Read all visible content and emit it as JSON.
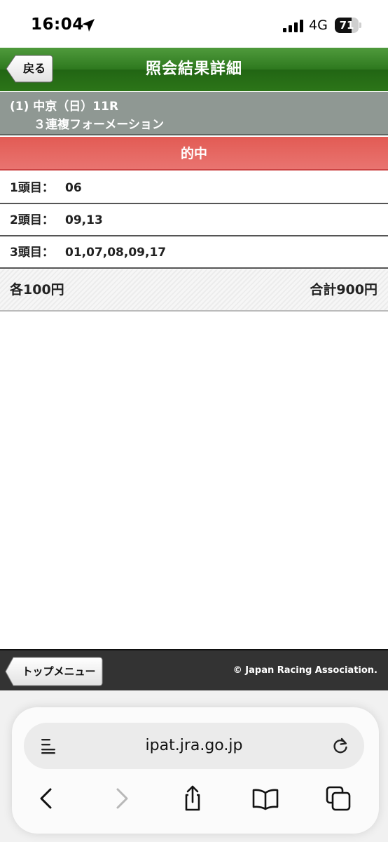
{
  "status_bar": {
    "time": "16:04",
    "network": "4G",
    "battery": "71",
    "battery_level": 0.71
  },
  "header": {
    "title": "照会結果詳細",
    "back_label": "戻る"
  },
  "race": {
    "line1": "(1) 中京（日）11R",
    "line2": "３連複フォーメーション"
  },
  "result": {
    "label": "的中"
  },
  "selections": [
    {
      "label": "1頭目：",
      "value": "06"
    },
    {
      "label": "2頭目：",
      "value": "09,13"
    },
    {
      "label": "3頭目：",
      "value": "01,07,08,09,17"
    }
  ],
  "totals": {
    "unit_price": "各100円",
    "total_price": "合計900円"
  },
  "footer": {
    "top_menu_label": "トップメニュー",
    "copyright": "© Japan Racing Association."
  },
  "browser": {
    "url": "ipat.jra.go.jp"
  },
  "colors": {
    "header_green": "#2f7a1f",
    "race_gray": "#8f9893",
    "hit_red": "#e25b54",
    "footer_dark": "#333333"
  }
}
